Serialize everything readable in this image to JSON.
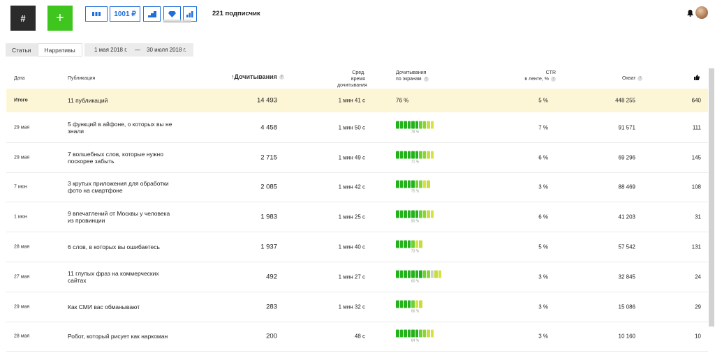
{
  "toolbar": {
    "hash_label": "#",
    "plus_label": "+",
    "balance": "1001 ₽",
    "subscribers": "221 подписчик"
  },
  "tabs": [
    {
      "label": "Статьи",
      "active": false
    },
    {
      "label": "Нарративы",
      "active": true
    }
  ],
  "daterange": {
    "from": "1 мая 2018 г.",
    "dash": "—",
    "to": "30 июля 2018 г."
  },
  "columns": {
    "date": "Дата",
    "publication": "Публикация",
    "reads": "Дочитывания",
    "avg_time_1": "Сред. время",
    "avg_time_2": "дочитывания",
    "screens_1": "Дочитывания",
    "screens_2": "по экранам",
    "ctr_1": "CTR",
    "ctr_2": "в ленте, %",
    "reach": "Охват"
  },
  "total": {
    "date": "Итого",
    "title": "11 публикаций",
    "reads": "14 493",
    "time": "1 мин 41 с",
    "screens": "76 %",
    "ctr": "5 %",
    "reach": "448 255",
    "likes": "640"
  },
  "rows": [
    {
      "date": "29 мая",
      "title": "5 функций в айфоне, о которых вы не знали",
      "reads": "4 458",
      "time": "1 мин 50 с",
      "screens_pct": "78 %",
      "bars": 10,
      "ctr": "7 %",
      "reach": "91 571",
      "likes": "111"
    },
    {
      "date": "29 мая",
      "title": "7 волшебных слов, которые нужно поскорее забыть",
      "reads": "2 715",
      "time": "1 мин 49 с",
      "screens_pct": "71 %",
      "bars": 10,
      "ctr": "6 %",
      "reach": "69 296",
      "likes": "145"
    },
    {
      "date": "7 июн",
      "title": "3 крутых приложения для обработки фото на смартфоне",
      "reads": "2 085",
      "time": "1 мин 42 с",
      "screens_pct": "75 %",
      "bars": 9,
      "ctr": "3 %",
      "reach": "88 469",
      "likes": "108"
    },
    {
      "date": "1 июн",
      "title": "9 впечатлений от Москвы у человека из провинции",
      "reads": "1 983",
      "time": "1 мин 25 с",
      "screens_pct": "90 %",
      "bars": 10,
      "ctr": "6 %",
      "reach": "41 203",
      "likes": "31"
    },
    {
      "date": "28 мая",
      "title": "6 слов, в которых вы ошибаетесь",
      "reads": "1 937",
      "time": "1 мин 40 с",
      "screens_pct": "73 %",
      "bars": 7,
      "ctr": "5 %",
      "reach": "57 542",
      "likes": "131"
    },
    {
      "date": "27 мая",
      "title": "11 глупых фраз на коммерческих сайтах",
      "reads": "492",
      "time": "1 мин 27 с",
      "screens_pct": "60 %",
      "bars": 12,
      "ctr": "3 %",
      "reach": "32 845",
      "likes": "24"
    },
    {
      "date": "29 мая",
      "title": "Как СМИ вас обманывают",
      "reads": "283",
      "time": "1 мин 32 с",
      "screens_pct": "66 %",
      "bars": 7,
      "ctr": "3 %",
      "reach": "15 086",
      "likes": "29"
    },
    {
      "date": "28 мая",
      "title": "Робот, который рисует как наркоман",
      "reads": "200",
      "time": "48 с",
      "screens_pct": "84 %",
      "bars": 10,
      "ctr": "3 %",
      "reach": "10 160",
      "likes": "10"
    }
  ]
}
